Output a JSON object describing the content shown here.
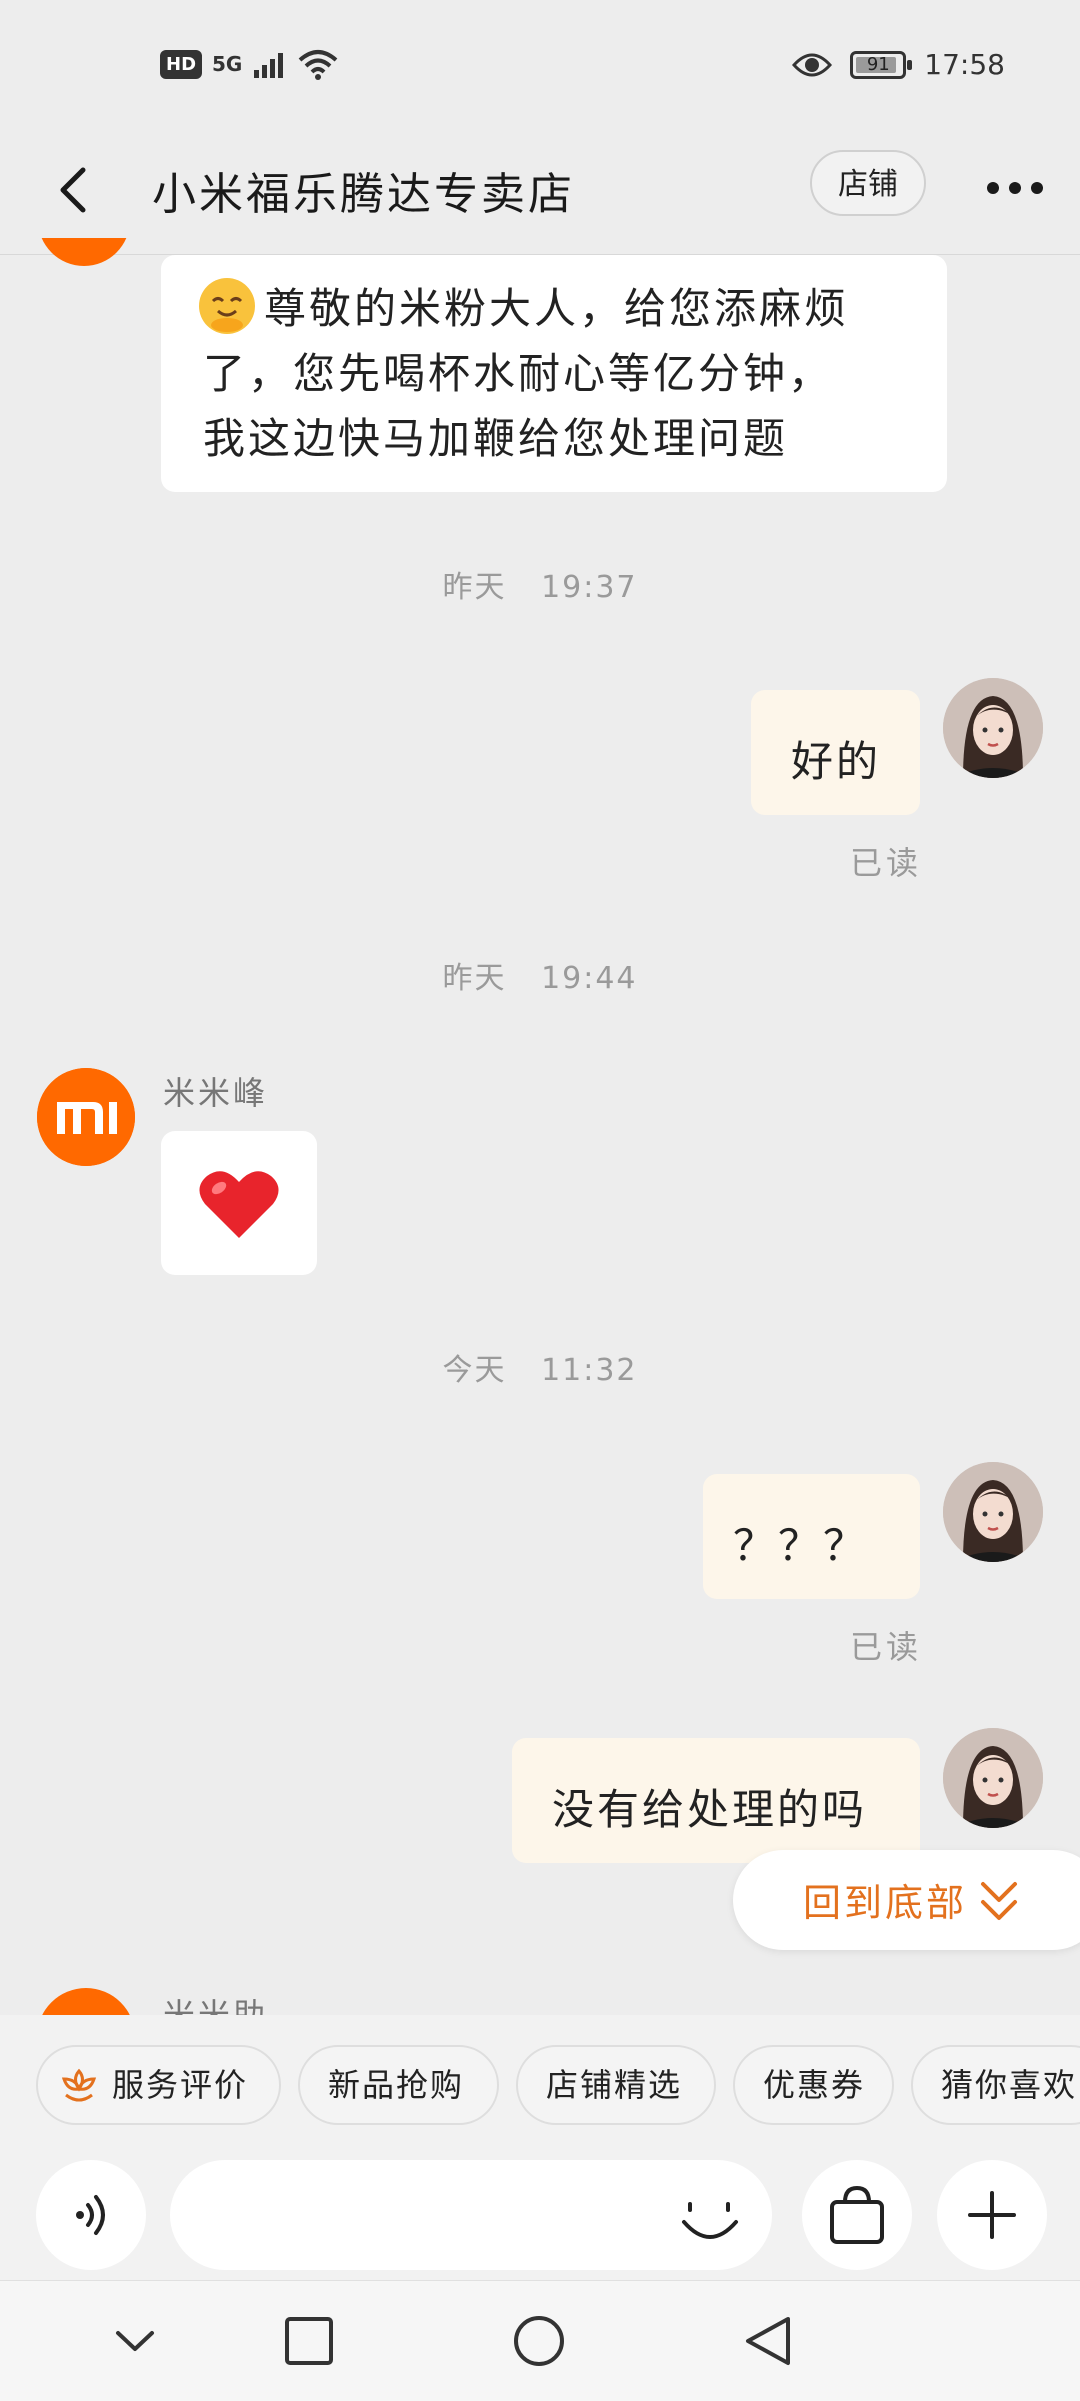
{
  "status_bar": {
    "hd": "HD",
    "network": "5G",
    "battery": "91",
    "battery_level": 0.91,
    "time": "17:58"
  },
  "header": {
    "title": "小米福乐腾达专卖店",
    "shop_button": "店铺"
  },
  "messages": [
    {
      "side": "left",
      "text_lines": [
        "尊敬的米粉大人，给您添麻烦",
        "了，您先喝杯水耐心等亿分钟，",
        "我这边快马加鞭给您处理问题"
      ]
    },
    {
      "type": "time",
      "label": "昨天",
      "time": "19:37"
    },
    {
      "side": "right",
      "text": "好的",
      "read": "已读"
    },
    {
      "type": "time",
      "label": "昨天",
      "time": "19:44"
    },
    {
      "side": "left",
      "sender": "米米峰",
      "emoji": "heart"
    },
    {
      "type": "time",
      "label": "今天",
      "time": "11:32"
    },
    {
      "side": "right",
      "text": "？？？",
      "read": "已读"
    },
    {
      "side": "right",
      "text": "没有给处理的吗"
    },
    {
      "side": "left",
      "sender": "米米助"
    }
  ],
  "back_to_bottom": "回到底部",
  "chips": [
    "服务评价",
    "新品抢购",
    "店铺精选",
    "优惠券",
    "猜你喜欢"
  ],
  "colors": {
    "accent": "#e3711e",
    "brand": "#ff6900",
    "bubble_right": "#fdf6ea",
    "background": "#ededed"
  }
}
